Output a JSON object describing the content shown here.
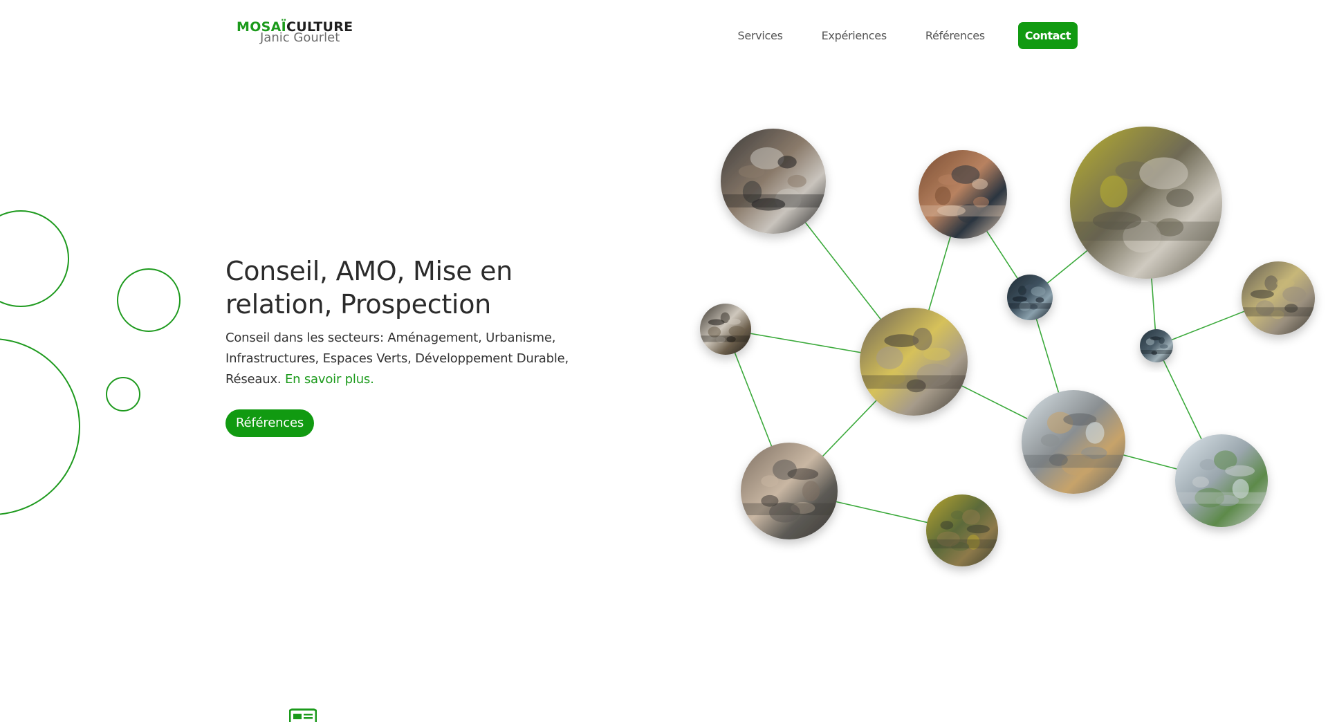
{
  "brand": {
    "name_part1": "MOSAÏ",
    "name_part2": "CULTURE",
    "subtitle": "Janic Gourlet"
  },
  "nav": {
    "items": [
      {
        "label": "Services"
      },
      {
        "label": "Expériences"
      },
      {
        "label": "Références"
      }
    ],
    "contact_label": "Contact"
  },
  "hero": {
    "title": "Conseil, AMO, Mise en relation, Prospection",
    "description": "Conseil dans les secteurs: Aménagement, Urbanisme, Infrastructures, Espaces Verts, Développement Durable, Réseaux.",
    "link_label": "En savoir plus.",
    "button_label": "Références"
  },
  "colors": {
    "accent": "#119a11",
    "line": "#3caa3c",
    "text": "#2a2a2a"
  },
  "network": {
    "images": [
      {
        "id": "business-meeting",
        "name": "business-meeting-photo",
        "palette": [
          "#3b3a3a",
          "#8a7a6a",
          "#c9c4bd",
          "#1d1d1d"
        ]
      },
      {
        "id": "hands-team",
        "name": "team-hands-photo",
        "palette": [
          "#7a4e33",
          "#b88260",
          "#2b3540",
          "#e0c6ae"
        ]
      },
      {
        "id": "park-stairs",
        "name": "park-stairs-photo",
        "palette": [
          "#b9b02e",
          "#6f6a55",
          "#cfcac0",
          "#5a5647"
        ]
      },
      {
        "id": "city-night",
        "name": "city-night-photo",
        "palette": [
          "#1e2a33",
          "#3f5260",
          "#8aa0ac",
          "#101820"
        ]
      },
      {
        "id": "road-aerial-small",
        "name": "road-aerial-photo",
        "palette": [
          "#5f5a52",
          "#c7b779",
          "#9a8f7e",
          "#3d3a35"
        ]
      },
      {
        "id": "flowers",
        "name": "flowers-photo",
        "palette": [
          "#3a352e",
          "#cfc8bd",
          "#6b5e4b",
          "#1f1c18"
        ]
      },
      {
        "id": "highway-aerial",
        "name": "highway-aerial-photo",
        "palette": [
          "#6b6257",
          "#d6c15a",
          "#a69b8a",
          "#3e3a35"
        ]
      },
      {
        "id": "city-dusk",
        "name": "city-dusk-photo",
        "palette": [
          "#22313b",
          "#4b5d69",
          "#9fb0b8",
          "#141c22"
        ]
      },
      {
        "id": "crane-building",
        "name": "construction-crane-photo",
        "palette": [
          "#dbe5ea",
          "#8a8f92",
          "#c7a36a",
          "#5e6366"
        ]
      },
      {
        "id": "construction-site",
        "name": "construction-site-aerial-photo",
        "palette": [
          "#7d6f62",
          "#c9b7a3",
          "#5c5a55",
          "#3f3b36"
        ]
      },
      {
        "id": "modern-building",
        "name": "modern-building-photo",
        "palette": [
          "#dfe8ee",
          "#9aa6ad",
          "#5d8a4a",
          "#c8cdd0"
        ]
      },
      {
        "id": "autumn-forest",
        "name": "autumn-forest-aerial-photo",
        "palette": [
          "#b9a52e",
          "#5b6a3a",
          "#8e7a4a",
          "#3b4030"
        ]
      }
    ]
  }
}
